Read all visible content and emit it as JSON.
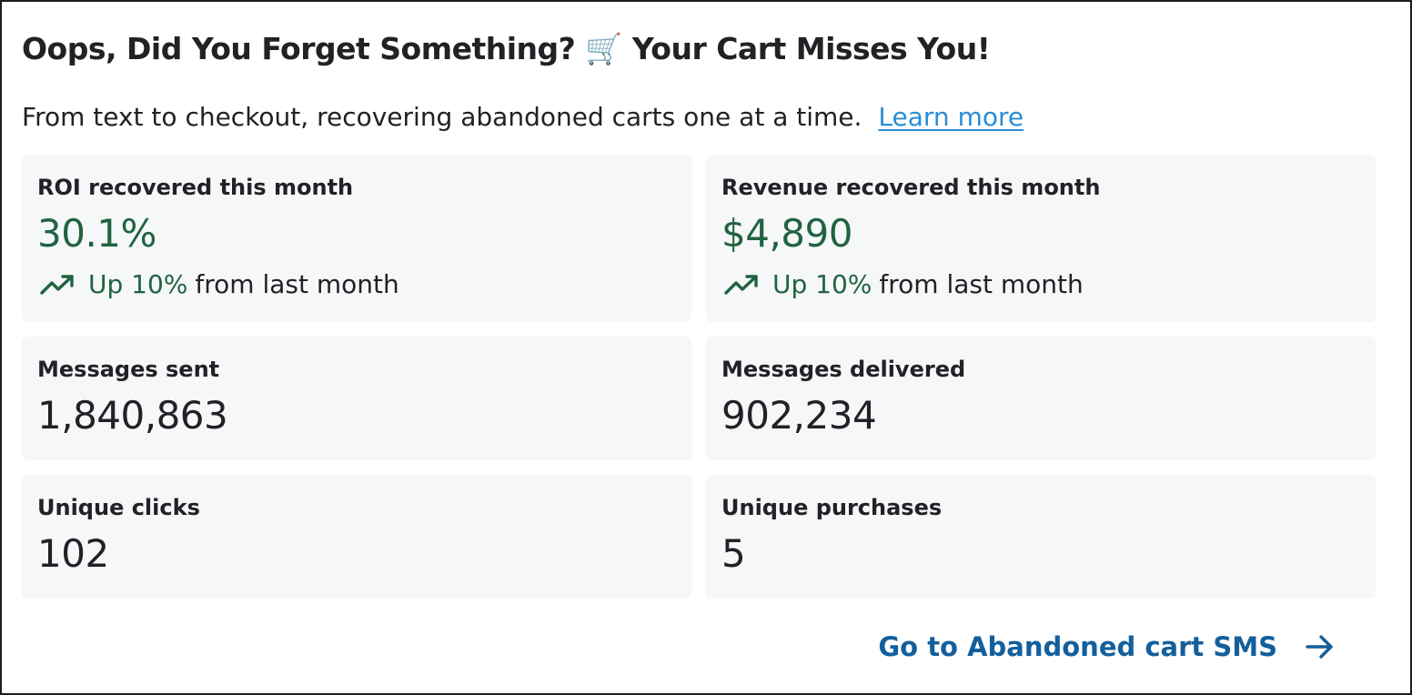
{
  "header": {
    "title_before": "Oops, Did You Forget Something?",
    "title_emoji": "🛒",
    "title_after": "Your Cart Misses You!",
    "subtitle": "From text to checkout, recovering abandoned carts one at a time.",
    "learn_more": "Learn more"
  },
  "metrics": {
    "roi": {
      "label": "ROI recovered this month",
      "value": "30.1%",
      "trend_up": "Up 10%",
      "trend_rest": "from last month"
    },
    "revenue": {
      "label": "Revenue recovered this month",
      "value": "$4,890",
      "trend_up": "Up 10%",
      "trend_rest": "from last month"
    },
    "sent": {
      "label": "Messages sent",
      "value": "1,840,863"
    },
    "delivered": {
      "label": "Messages delivered",
      "value": "902,234"
    },
    "clicks": {
      "label": "Unique clicks",
      "value": "102"
    },
    "purchases": {
      "label": "Unique purchases",
      "value": "5"
    }
  },
  "footer": {
    "link_label": "Go to Abandoned cart SMS"
  },
  "colors": {
    "accent_green": "#216340",
    "link_blue": "#2a8dd6",
    "cta_blue": "#135f9c",
    "tile_bg": "#f6f7f9"
  },
  "icons": {
    "trend": "trending-up-icon",
    "arrow": "arrow-right-icon",
    "cart": "shopping-cart-emoji"
  }
}
